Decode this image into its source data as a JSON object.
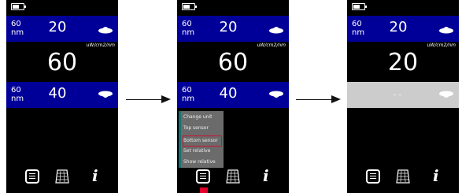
{
  "screens": [
    {
      "top_band": {
        "wavelength": "60\nnm",
        "value": "20"
      },
      "unit": "uW/cm2/nm",
      "big_value": "60",
      "bottom_band": {
        "wavelength": "60\nnm",
        "value": "40"
      }
    },
    {
      "top_band": {
        "wavelength": "60\nnm",
        "value": "20"
      },
      "unit": "uW/cm2/nm",
      "big_value": "60",
      "bottom_band": {
        "wavelength": "60\nnm",
        "value": "40"
      },
      "menu": {
        "items": [
          "Change unit",
          "Top sensor",
          "Bottom sensor",
          "Set relative",
          "Show relative"
        ],
        "selected": "Bottom sensor"
      }
    },
    {
      "top_band": {
        "wavelength": "60\nnm",
        "value": "20"
      },
      "unit": "uW/cm2/nm",
      "big_value": "20",
      "bottom_band": {
        "wavelength": "",
        "value": "--"
      }
    }
  ],
  "icons": {
    "menu": "menu-icon",
    "grid": "grid-keypad-icon",
    "info": "info-icon",
    "info_glyph": "i",
    "sensor": "sensor-dome-icon",
    "battery": "battery-icon"
  },
  "colors": {
    "band": "#000099",
    "band_inactive": "#cccccc",
    "selection": "#cc1133",
    "pointer": "#e0002a"
  }
}
